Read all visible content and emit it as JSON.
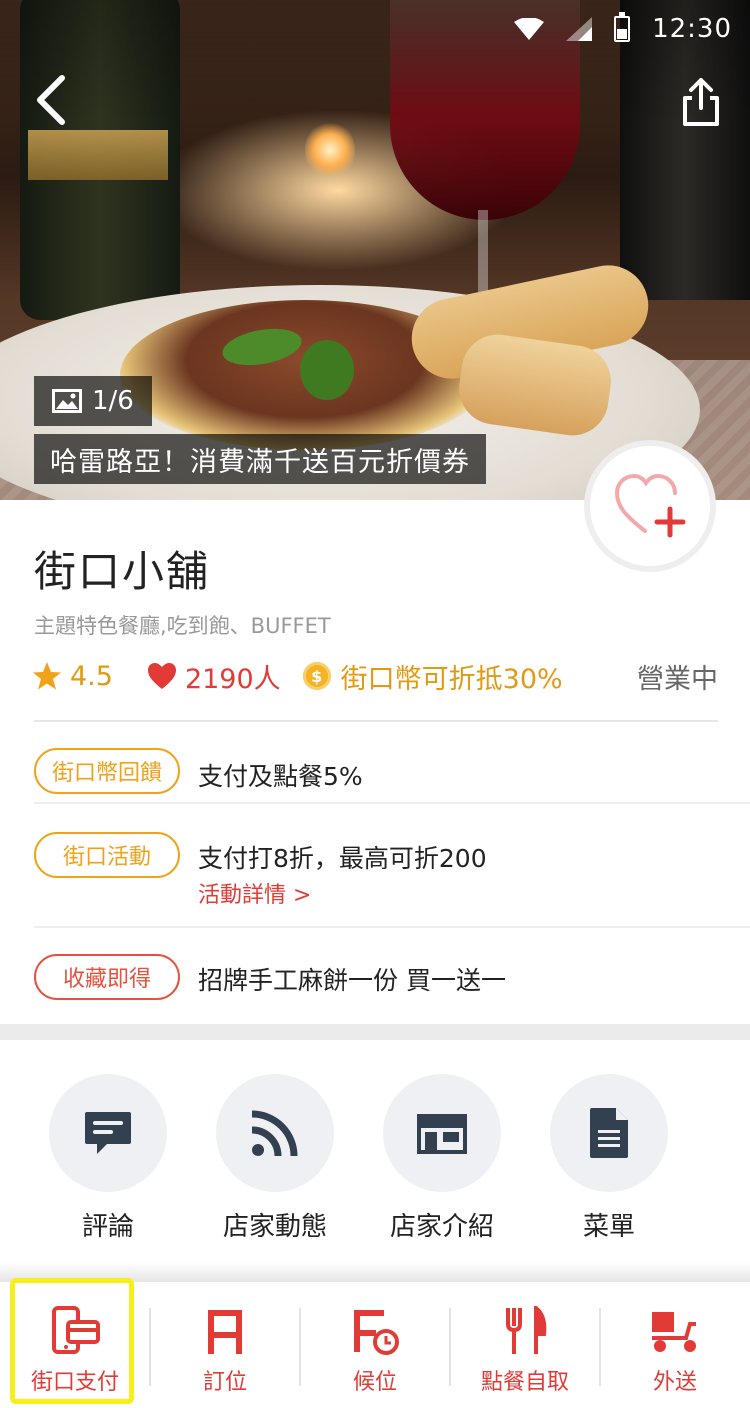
{
  "status_bar": {
    "time": "12:30",
    "battery_level": 0.45
  },
  "hero": {
    "photo_index": "1/6",
    "promo_text": "哈雷路亞！消費滿千送百元折價券",
    "icons": [
      "back-arrow-icon",
      "share-icon",
      "image-icon",
      "favorite-add-icon"
    ]
  },
  "store": {
    "name": "街口小舖",
    "category": "主題特色餐廳,吃到飽、BUFFET",
    "rating": "4.5",
    "likes": "2190人",
    "coin_symbol": "$",
    "coin_text": "街口幣可折抵30%",
    "status": "營業中"
  },
  "offers": [
    {
      "tag": "街口幣回饋",
      "text": "支付及點餐5%",
      "tag_color": "#f0a21a"
    },
    {
      "tag": "街口活動",
      "text": "支付打8折，最高可折200",
      "link": "活動詳情 >",
      "tag_color": "#f0a21a"
    },
    {
      "tag": "收藏即得",
      "text": "招牌手工麻餅一份 買一送一",
      "tag_color": "#e5523e"
    }
  ],
  "shortcuts": [
    {
      "label": "評論",
      "icon": "comment-icon"
    },
    {
      "label": "店家動態",
      "icon": "rss-feed-icon"
    },
    {
      "label": "店家介紹",
      "icon": "storefront-icon"
    },
    {
      "label": "菜單",
      "icon": "document-icon"
    }
  ],
  "bottom_nav": [
    {
      "label": "街口支付",
      "icon": "mobile-pay-icon",
      "highlighted": true
    },
    {
      "label": "訂位",
      "icon": "chair-icon"
    },
    {
      "label": "候位",
      "icon": "waitlist-clock-icon"
    },
    {
      "label": "點餐自取",
      "icon": "fork-knife-icon"
    },
    {
      "label": "外送",
      "icon": "delivery-scooter-icon"
    }
  ],
  "colors": {
    "accent_red": "#e23a36",
    "accent_orange": "#e39a13",
    "icon_dark": "#33404f",
    "highlight_yellow": "#f6ef1a"
  }
}
